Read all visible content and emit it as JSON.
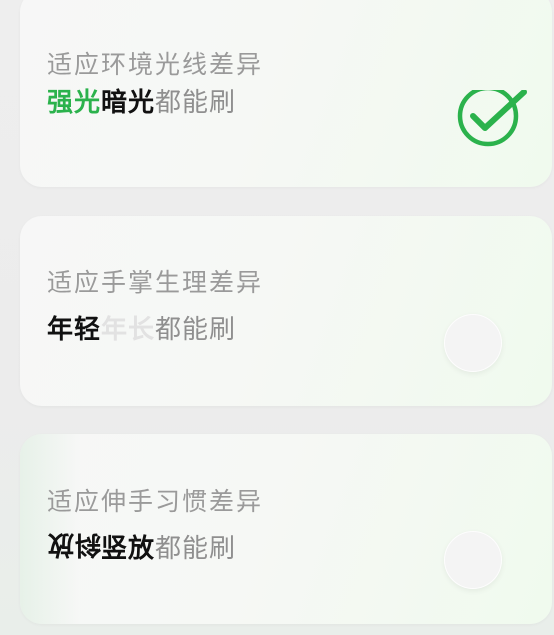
{
  "options": [
    {
      "subtitle": "适应环境光线差异",
      "parts": [
        "强光",
        "暗光",
        "都能刷"
      ],
      "selected": true
    },
    {
      "subtitle": "适应手掌生理差异",
      "parts": [
        "年轻",
        "年长",
        "都能刷"
      ],
      "selected": false
    },
    {
      "subtitle": "适应伸手习惯差异",
      "parts": [
        "斜放",
        "竖放",
        "都能刷"
      ],
      "selected": false
    }
  ],
  "colors": {
    "accent_green": "#2bb24c",
    "text_black": "#111111",
    "subtitle_gray": "#9a9a9a",
    "faded_gray": "#e2e2e2"
  },
  "icons": {
    "selected": "check-circle-icon",
    "unselected": "radio-circle-icon"
  }
}
